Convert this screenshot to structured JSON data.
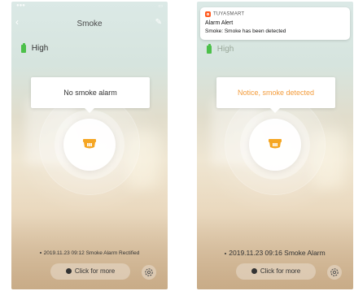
{
  "colors": {
    "battery_green": "#4cc04a",
    "accent_orange": "#f5a623",
    "alert_text_orange": "#f39c3c",
    "normal_text": "#333333",
    "notification_logo": "#ff5a1f"
  },
  "left": {
    "nav": {
      "title": "Smoke",
      "back_icon": "chevron-left-icon",
      "edit_icon": "pencil-icon"
    },
    "battery": {
      "label": "High",
      "icon": "battery-icon"
    },
    "status_bubble": {
      "text": "No smoke alarm"
    },
    "device_icon": "smoke-detector-icon",
    "log": {
      "text": "2019.11.23 09:12 Smoke Alarm Rectified"
    },
    "more_button": {
      "label": "Click for more",
      "icon": "clock-icon"
    },
    "settings_icon": "gear-icon"
  },
  "right": {
    "notification": {
      "app_name": "TUYASMART",
      "title": "Alarm Alert",
      "body": "Smoke: Smoke has been detected",
      "logo_icon": "tuyasmart-logo-icon"
    },
    "battery": {
      "label": "High",
      "icon": "battery-icon"
    },
    "status_bubble": {
      "text": "Notice, smoke detected"
    },
    "device_icon": "smoke-detector-icon",
    "log": {
      "text": "2019.11.23 09:16 Smoke Alarm"
    },
    "more_button": {
      "label": "Click for more",
      "icon": "clock-icon"
    },
    "settings_icon": "gear-icon"
  }
}
